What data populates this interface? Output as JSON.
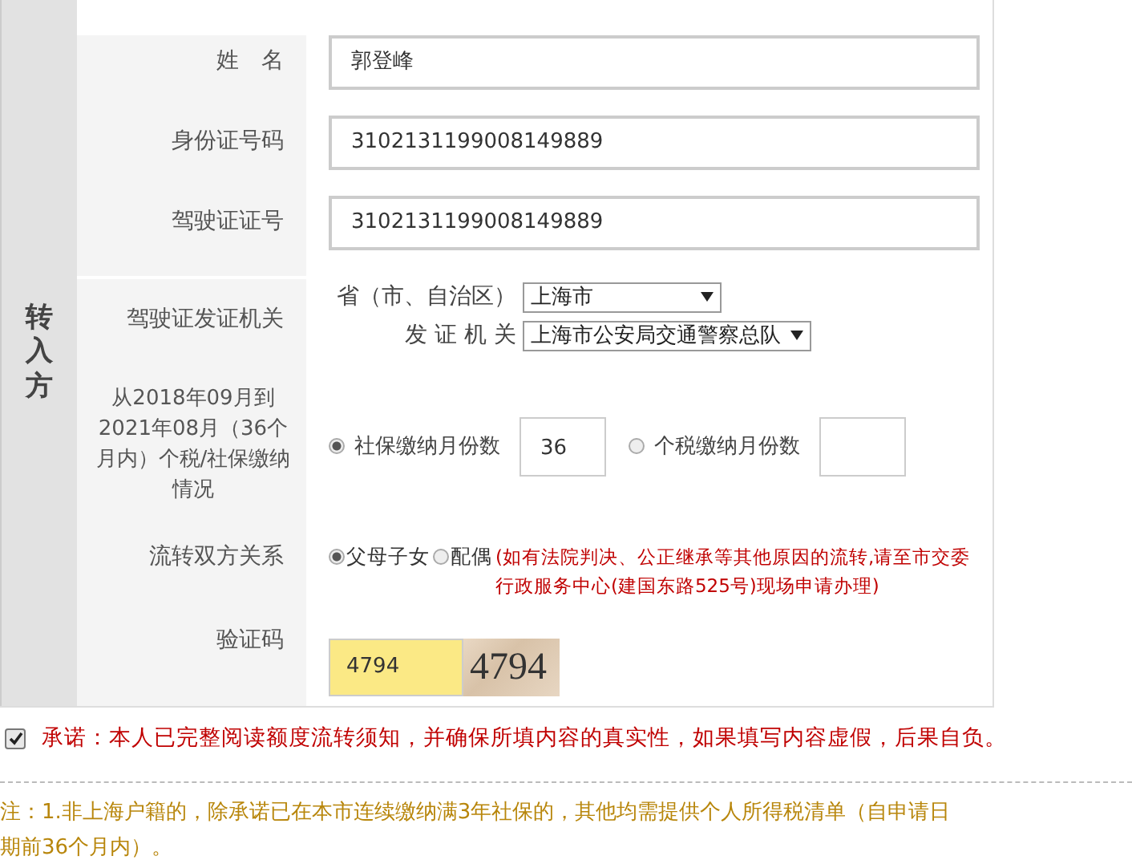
{
  "side_label": "转入方",
  "fields": [
    {
      "kind": "text",
      "label": "姓　名",
      "value": "郭登峰"
    },
    {
      "kind": "text",
      "label": "身份证号码",
      "value": "3102131199008149889"
    },
    {
      "kind": "text",
      "label": "驾驶证证号",
      "value": "3102131199008149889"
    },
    {
      "kind": "selects",
      "label": "驾驶证发证机关",
      "selects": [
        {
          "label": "省（市、自治区）",
          "value": "上海市"
        },
        {
          "label": "发 证 机 关",
          "value": "上海市公安局交通警察总队"
        }
      ]
    },
    {
      "kind": "months",
      "label": "从2018年09月到2021年08月（36个月内）个税/社保缴纳情况",
      "options": [
        {
          "label": "社保缴纳月份数",
          "selected": true,
          "value": "36"
        },
        {
          "label": "个税缴纳月份数",
          "selected": false
        }
      ]
    },
    {
      "kind": "relation",
      "label": "流转双方关系",
      "options": [
        {
          "label": "父母子女",
          "selected": true
        },
        {
          "label": "配偶",
          "selected": false
        }
      ],
      "note": "(如有法院判决、公正继承等其他原因的流转,请至市交委行政服务中心(建国东路525号)现场申请办理)"
    },
    {
      "kind": "captcha",
      "label": "验证码",
      "value": "4794",
      "image_text": "4794"
    }
  ],
  "pledge": {
    "checked": true,
    "text": "承诺：本人已完整阅读额度流转须知，并确保所填内容的真实性，如果填写内容虚假，后果自负。"
  },
  "note": "注：1.非上海户籍的，除承诺已在本市连续缴纳满3年社保的，其他均需提供个人所得税清单（自申请日期前36个月内）。"
}
